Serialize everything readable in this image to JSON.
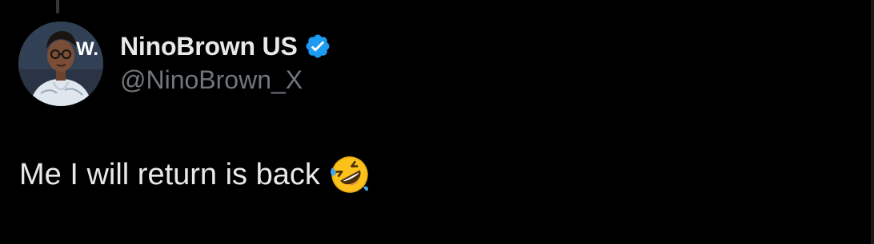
{
  "tweet": {
    "author": {
      "display_name": "NinoBrown US",
      "handle": "@NinoBrown_X",
      "verified": true,
      "avatar_backdrop_text": "W."
    },
    "text": "Me I will return is back",
    "emoji": "rolling-on-the-floor-laughing-icon"
  },
  "colors": {
    "background": "#000000",
    "primary_text": "#e7e9ea",
    "secondary_text": "#71767b",
    "verified_badge": "#1d9bf0"
  }
}
